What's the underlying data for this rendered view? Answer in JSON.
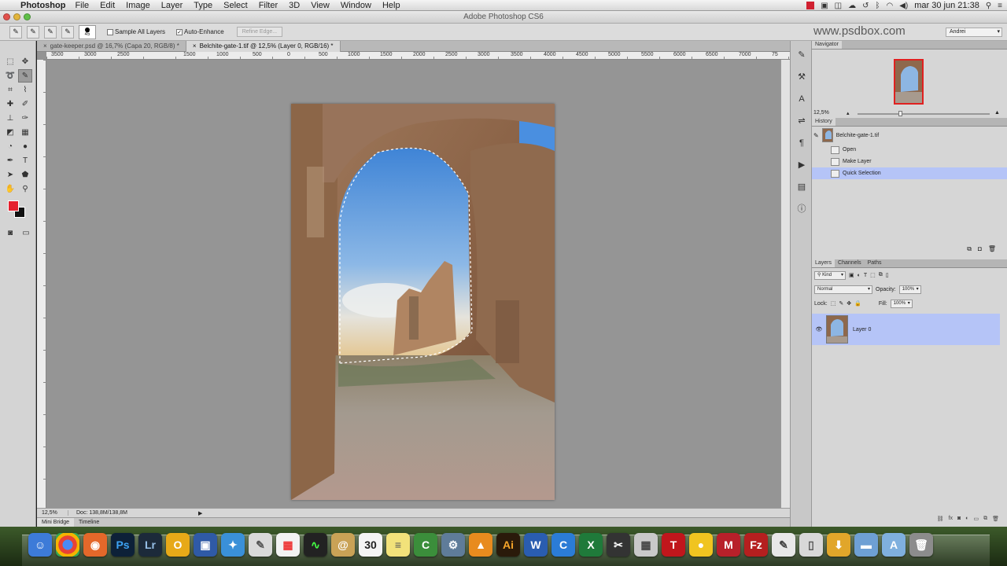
{
  "menubar": {
    "app_name": "Photoshop",
    "items": [
      "File",
      "Edit",
      "Image",
      "Layer",
      "Type",
      "Select",
      "Filter",
      "3D",
      "View",
      "Window",
      "Help"
    ],
    "clock": "mar 30 jun  21:38"
  },
  "window": {
    "title": "Adobe Photoshop CS6"
  },
  "options": {
    "brush_size": "45",
    "sample_all_layers": "Sample All Layers",
    "auto_enhance": "Auto-Enhance",
    "refine_edge": "Refine Edge...",
    "watermark_url": "www.psdbox.com",
    "workspace": "Andrei"
  },
  "tabs": [
    {
      "label": "gate-keeper.psd @ 16,7% (Capa 20, RGB/8) *"
    },
    {
      "label": "Belchite-gate-1.tif @ 12,5% (Layer 0, RGB/16) *"
    }
  ],
  "ruler": [
    "3500",
    "3000",
    "2500",
    "1500",
    "1000",
    "500",
    "0",
    "500",
    "1000",
    "1500",
    "2000",
    "2500",
    "3000",
    "3500",
    "4000",
    "4500",
    "5000",
    "5500",
    "6000",
    "6500",
    "7000",
    "75"
  ],
  "status": {
    "zoom": "12,5%",
    "doc": "Doc: 138,8M/138,8M"
  },
  "bottom_tabs": [
    "Mini Bridge",
    "Timeline"
  ],
  "navigator": {
    "tab": "Navigator",
    "zoom": "12,5%"
  },
  "history": {
    "tab": "History",
    "snapshot": "Belchite-gate-1.tif",
    "steps": [
      "Open",
      "Make Layer",
      "Quick Selection"
    ]
  },
  "layers": {
    "tabs": [
      "Layers",
      "Channels",
      "Paths"
    ],
    "kind": "Kind",
    "blend": "Normal",
    "opacity_label": "Opacity:",
    "opacity": "100%",
    "lock_label": "Lock:",
    "fill_label": "Fill:",
    "fill": "100%",
    "layer_name": "Layer 0"
  },
  "colors": {
    "foreground": "#e5202e",
    "background": "#111111",
    "selection": "#b5c4f7"
  }
}
